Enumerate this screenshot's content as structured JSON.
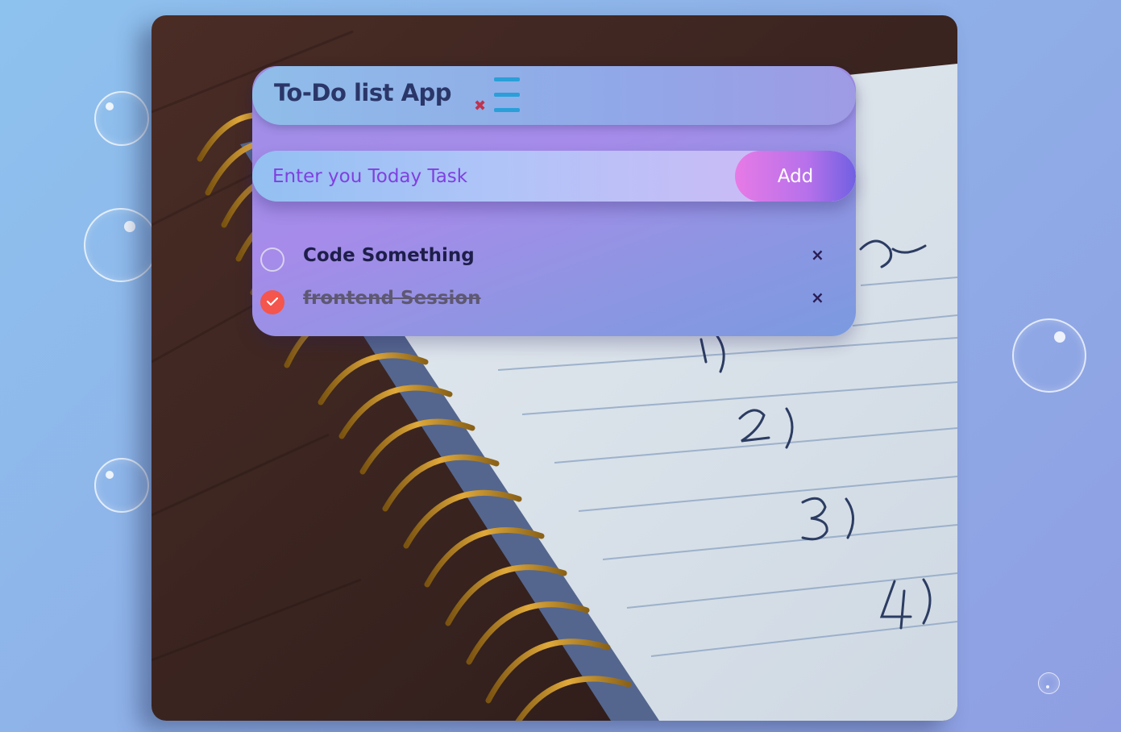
{
  "app": {
    "title": "To-Do list App",
    "close_icon": "close-icon",
    "menu_icon": "hamburger-menu-icon"
  },
  "input": {
    "placeholder": "Enter you Today Task",
    "value": ""
  },
  "add_button": {
    "label": "Add"
  },
  "tasks": [
    {
      "text": "Code Something",
      "completed": false,
      "delete_glyph": "×"
    },
    {
      "text": "frontend Session",
      "completed": true,
      "delete_glyph": "×"
    }
  ],
  "colors": {
    "accent_purple": "#7b3fe4",
    "check_done": "#f4554d",
    "menu_blue": "#2a9fd8",
    "title_text": "#2b3668"
  }
}
